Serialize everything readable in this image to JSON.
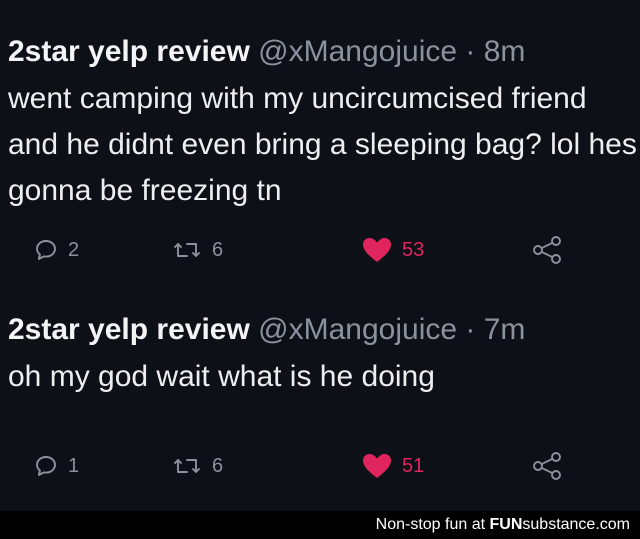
{
  "tweets": [
    {
      "display_name": "2star yelp review",
      "handle": "@xMangojuice",
      "separator": "·",
      "time": "8m",
      "text": "went camping with my uncircumcised friend and he didnt even bring a sleeping bag? lol hes gonna be freezing tn",
      "actions": {
        "reply_count": "2",
        "retweet_count": "6",
        "like_count": "53",
        "liked": true
      }
    },
    {
      "display_name": "2star yelp review",
      "handle": "@xMangojuice",
      "separator": "·",
      "time": "7m",
      "text": "oh my god wait what is he doing",
      "actions": {
        "reply_count": "1",
        "retweet_count": "6",
        "like_count": "51",
        "liked": true
      }
    }
  ],
  "watermark": {
    "prefix": "Non-stop fun at ",
    "brand_part1": "FUN",
    "brand_part2": "substance",
    "brand_suffix": ".com"
  },
  "colors": {
    "background": "#0d1017",
    "text": "#eeeef0",
    "muted": "#8c929d",
    "like": "#e0245e"
  },
  "icons": {
    "reply": "reply-bubble-icon",
    "retweet": "retweet-icon",
    "like": "heart-icon",
    "share": "share-icon"
  }
}
